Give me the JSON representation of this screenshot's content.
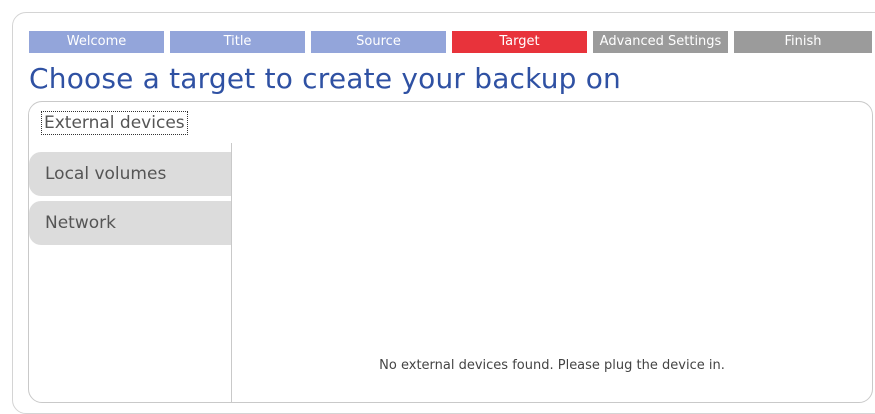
{
  "wizard": {
    "steps": [
      {
        "label": "Welcome",
        "state": "done"
      },
      {
        "label": "Title",
        "state": "done"
      },
      {
        "label": "Source",
        "state": "done"
      },
      {
        "label": "Target",
        "state": "active"
      },
      {
        "label": "Advanced Settings",
        "state": "todo"
      },
      {
        "label": "Finish",
        "state": "todo"
      }
    ]
  },
  "page": {
    "title": "Choose a target to create your backup on"
  },
  "targets": {
    "tabs": [
      {
        "label": "External devices",
        "selected": true
      },
      {
        "label": "Local volumes",
        "selected": false
      },
      {
        "label": "Network",
        "selected": false
      }
    ],
    "empty_message": "No external devices found. Please plug the device in."
  },
  "colors": {
    "step_done": "#93a5da",
    "step_active": "#e8333b",
    "step_todo": "#9b9b9b",
    "title": "#2f51a3",
    "tab_inactive_bg": "#dcdcdc"
  }
}
